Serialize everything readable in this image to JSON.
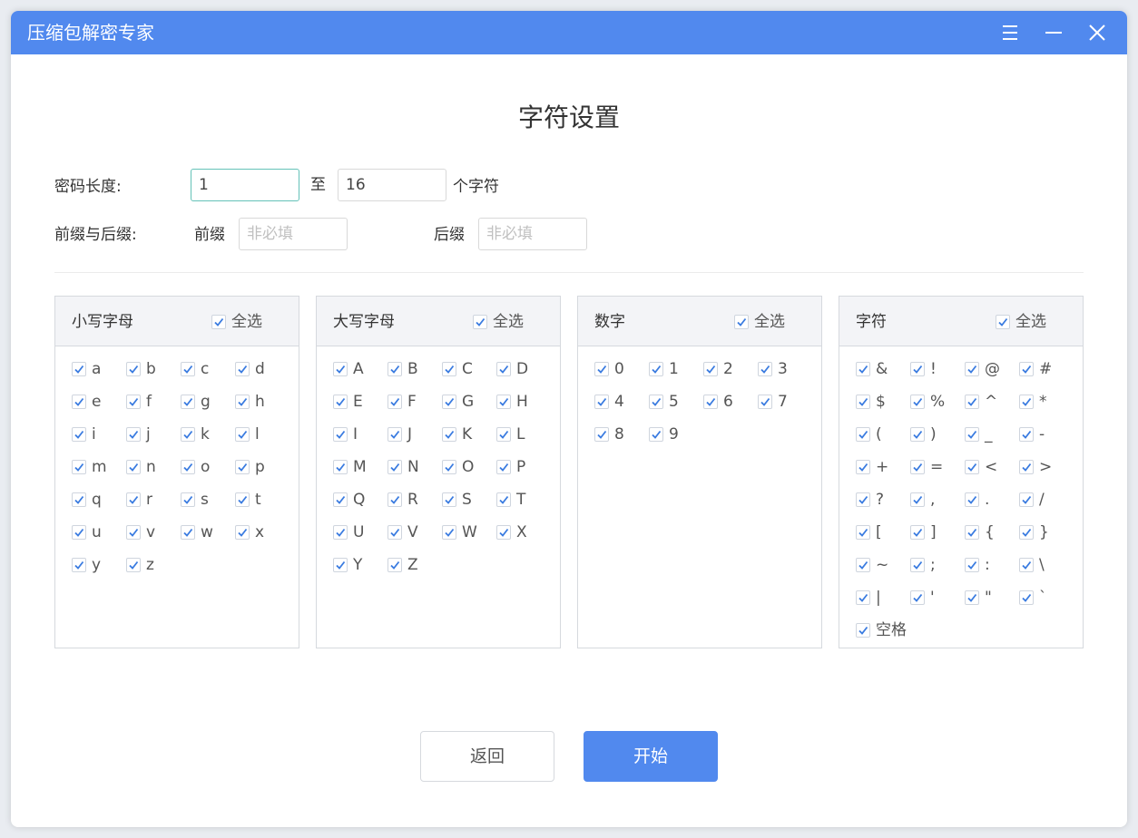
{
  "window": {
    "title": "压缩包解密专家"
  },
  "page": {
    "title": "字符设置"
  },
  "password_length": {
    "label": "密码长度:",
    "min_value": "1",
    "to_label": "至",
    "max_value": "16",
    "unit_label": "个字符"
  },
  "affix": {
    "label": "前缀与后缀:",
    "prefix_label": "前缀",
    "prefix_placeholder": "非必填",
    "prefix_value": "",
    "suffix_label": "后缀",
    "suffix_placeholder": "非必填",
    "suffix_value": ""
  },
  "panels": [
    {
      "title": "小写字母",
      "select_all_label": "全选",
      "select_all_checked": true,
      "items": [
        "a",
        "b",
        "c",
        "d",
        "e",
        "f",
        "g",
        "h",
        "i",
        "j",
        "k",
        "l",
        "m",
        "n",
        "o",
        "p",
        "q",
        "r",
        "s",
        "t",
        "u",
        "v",
        "w",
        "x",
        "y",
        "z"
      ]
    },
    {
      "title": "大写字母",
      "select_all_label": "全选",
      "select_all_checked": true,
      "items": [
        "A",
        "B",
        "C",
        "D",
        "E",
        "F",
        "G",
        "H",
        "I",
        "J",
        "K",
        "L",
        "M",
        "N",
        "O",
        "P",
        "Q",
        "R",
        "S",
        "T",
        "U",
        "V",
        "W",
        "X",
        "Y",
        "Z"
      ]
    },
    {
      "title": "数字",
      "select_all_label": "全选",
      "select_all_checked": true,
      "items": [
        "0",
        "1",
        "2",
        "3",
        "4",
        "5",
        "6",
        "7",
        "8",
        "9"
      ]
    },
    {
      "title": "字符",
      "select_all_label": "全选",
      "select_all_checked": true,
      "items": [
        "&",
        "!",
        "@",
        "#",
        "$",
        "%",
        "^",
        "*",
        "(",
        ")",
        "_",
        "-",
        "+",
        "=",
        "<",
        ">",
        "?",
        ",",
        ".",
        "/",
        "[",
        "]",
        "{",
        "}",
        "~",
        ";",
        ":",
        "\\",
        "|",
        "'",
        "\"",
        "`",
        "空格"
      ]
    }
  ],
  "buttons": {
    "back_label": "返回",
    "start_label": "开始"
  },
  "colors": {
    "accent": "#5189ee",
    "check": "#3a7be0",
    "focus_border": "#64c2b8"
  },
  "icons": {
    "menu": "menu-icon",
    "minimize": "minimize-icon",
    "close": "close-icon",
    "check": "checkmark-icon"
  }
}
